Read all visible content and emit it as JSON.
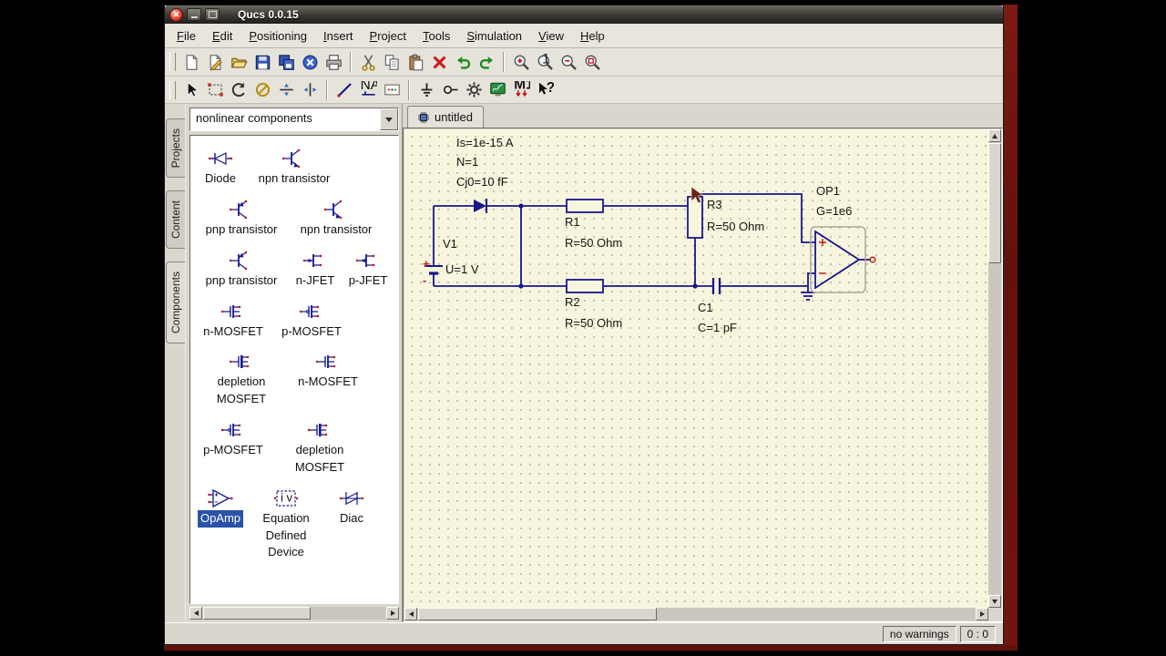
{
  "window": {
    "title": "Qucs 0.0.15"
  },
  "menu": {
    "items": [
      "File",
      "Edit",
      "Positioning",
      "Insert",
      "Project",
      "Tools",
      "Simulation",
      "View",
      "Help"
    ]
  },
  "toolbars": {
    "file": [
      {
        "name": "new-document",
        "icon": "new-doc"
      },
      {
        "name": "new-text-document",
        "icon": "new-text"
      },
      {
        "name": "open-document",
        "icon": "open"
      },
      {
        "name": "save-document",
        "icon": "save"
      },
      {
        "name": "save-all-documents",
        "icon": "save-all"
      },
      {
        "name": "close-document",
        "icon": "close-doc"
      },
      {
        "name": "print",
        "icon": "print"
      },
      {
        "sep": true
      },
      {
        "name": "cut",
        "icon": "cut"
      },
      {
        "name": "copy",
        "icon": "copy"
      },
      {
        "name": "paste",
        "icon": "paste"
      },
      {
        "name": "delete",
        "icon": "delete"
      },
      {
        "name": "undo",
        "icon": "undo"
      },
      {
        "name": "redo",
        "icon": "redo"
      },
      {
        "sep": true
      },
      {
        "name": "zoom-in",
        "icon": "zoom-in"
      },
      {
        "name": "zoom-reset",
        "icon": "zoom-1"
      },
      {
        "name": "zoom-out",
        "icon": "zoom-out"
      },
      {
        "name": "zoom-fit",
        "icon": "zoom-fit"
      }
    ],
    "edit": [
      {
        "name": "select-pointer",
        "icon": "pointer"
      },
      {
        "name": "edit-component-properties",
        "icon": "select-rect"
      },
      {
        "name": "rotate-component",
        "icon": "rotate"
      },
      {
        "name": "deactivate-component",
        "icon": "deactivate"
      },
      {
        "name": "mirror-about-x",
        "icon": "mirror-x"
      },
      {
        "name": "mirror-about-y",
        "icon": "mirror-y"
      },
      {
        "sep": true
      },
      {
        "name": "insert-wire",
        "icon": "wire"
      },
      {
        "name": "insert-wire-label",
        "icon": "wire-label"
      },
      {
        "name": "insert-equation",
        "icon": "equation"
      },
      {
        "sep": true
      },
      {
        "name": "insert-ground",
        "icon": "ground"
      },
      {
        "name": "insert-port",
        "icon": "port"
      },
      {
        "name": "simulate",
        "icon": "simulate"
      },
      {
        "name": "view-data-display",
        "icon": "data-display"
      },
      {
        "name": "set-marker",
        "icon": "marker"
      },
      {
        "name": "whats-this-help",
        "icon": "whats-this"
      }
    ]
  },
  "sidebar": {
    "tabs": [
      "Projects",
      "Content",
      "Components"
    ],
    "active_tab": "Components",
    "category_value": "nonlinear components",
    "items": [
      {
        "lines": [
          "Diode"
        ],
        "icon": "diode"
      },
      {
        "lines": [
          "npn transistor"
        ],
        "icon": "npn"
      },
      {
        "lines": [
          "pnp transistor"
        ],
        "icon": "pnp"
      },
      {
        "lines": [
          "npn transistor"
        ],
        "icon": "npn"
      },
      {
        "lines": [
          "pnp transistor"
        ],
        "icon": "pnp"
      },
      {
        "lines": [
          "n-JFET"
        ],
        "icon": "jfet-n"
      },
      {
        "lines": [
          "p-JFET"
        ],
        "icon": "jfet-p"
      },
      {
        "lines": [
          "n-MOSFET"
        ],
        "icon": "mosfet-n"
      },
      {
        "lines": [
          "p-MOSFET"
        ],
        "icon": "mosfet-p"
      },
      {
        "lines": [
          "depletion",
          "MOSFET"
        ],
        "icon": "mosfet-d"
      },
      {
        "lines": [
          "n-MOSFET"
        ],
        "icon": "mosfet-n"
      },
      {
        "lines": [
          "p-MOSFET"
        ],
        "icon": "mosfet-p"
      },
      {
        "lines": [
          "depletion",
          "MOSFET"
        ],
        "icon": "mosfet-d"
      },
      {
        "lines": [
          "OpAmp"
        ],
        "icon": "opamp",
        "selected": true
      },
      {
        "lines": [
          "Equation",
          "Defined",
          "Device"
        ],
        "icon": "eqndev"
      },
      {
        "lines": [
          "Diac"
        ],
        "icon": "diac"
      }
    ]
  },
  "document": {
    "tab_label": "untitled"
  },
  "schematic": {
    "diode_params": {
      "line1": "Is=1e-15 A",
      "line2": "N=1",
      "line3": "Cj0=10 fF"
    },
    "v1": {
      "name": "V1",
      "value": "U=1 V",
      "plus": "+",
      "minus": "-"
    },
    "r1": {
      "name": "R1",
      "value": "R=50 Ohm"
    },
    "r2": {
      "name": "R2",
      "value": "R=50 Ohm"
    },
    "r3": {
      "name": "R3",
      "value": "R=50 Ohm"
    },
    "c1": {
      "name": "C1",
      "value": "C=1 pF"
    },
    "op1": {
      "name": "OP1",
      "value": "G=1e6"
    }
  },
  "status": {
    "warnings": "no warnings",
    "cursor_position": "0 : 0"
  },
  "colors": {
    "wire": "#16168f",
    "canvas_bg": "#f8f5de",
    "selection_bg": "#2a52a8",
    "desktop": "#70160f"
  }
}
